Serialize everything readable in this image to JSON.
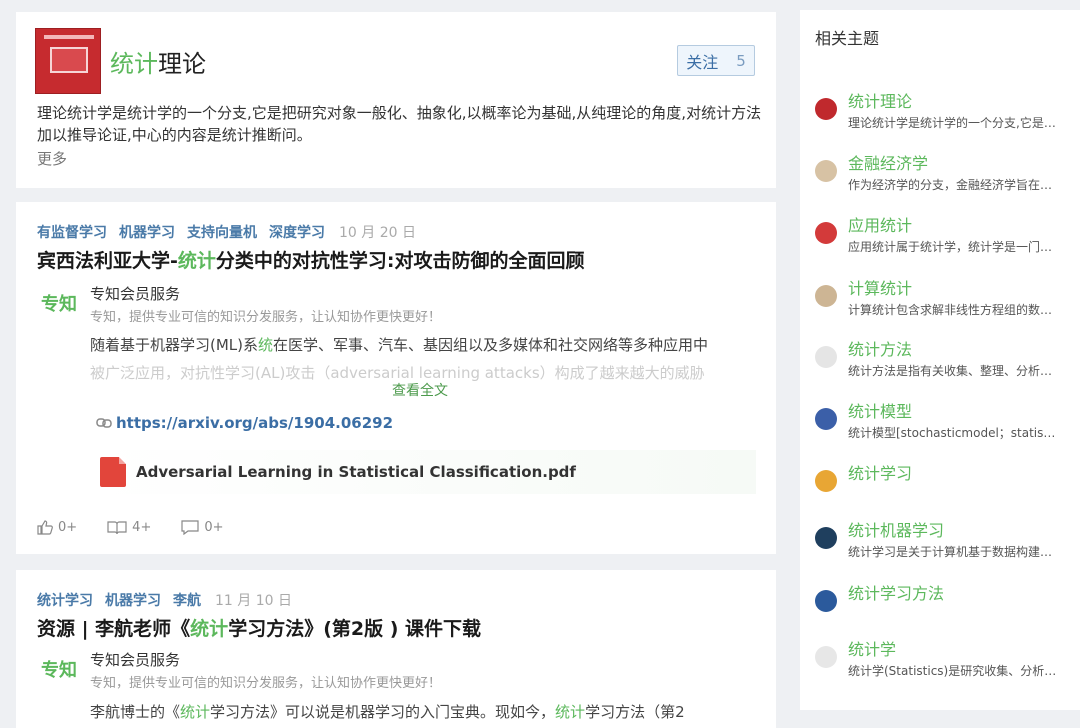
{
  "topic": {
    "title_hl": "统计",
    "title_rest": "理论",
    "follow_label": "关注",
    "follow_count": "5",
    "description": "理论统计学是统计学的一个分支,它是把研究对象一般化、抽象化,以概率论为基础,从纯理论的角度,对统计方法加以推导论证,中心的内容是统计推断问。",
    "more_label": "更多"
  },
  "articles": [
    {
      "tags": [
        "有监督学习",
        "机器学习",
        "支持向量机",
        "深度学习"
      ],
      "date": "10 月 20 日",
      "title_pre": "宾西法利亚大学-",
      "title_hl": "统计",
      "title_post": "分类中的对抗性学习:对攻击防御的全面回顾",
      "source_logo": "专知",
      "source_name": "专知会员服务",
      "source_desc": "专知，提供专业可信的知识分发服务，让认知协作更快更好！",
      "excerpt_pre": "随着基于机器学习(ML)系",
      "excerpt_hl": "统",
      "excerpt_post": "在医学、军事、汽车、基因组以及多媒体和社交网络等多种应用中",
      "excerpt_line2": "被广泛应用，对抗性学习(AL)攻击（adversarial learning attacks）构成了越来越大的威胁",
      "read_full": "查看全文",
      "link": "https://arxiv.org/abs/1904.06292",
      "pdf": "Adversarial Learning in Statistical Classification.pdf",
      "likes": "0+",
      "reads": "4+",
      "comments": "0+"
    },
    {
      "tags": [
        "统计学习",
        "机器学习",
        "李航"
      ],
      "date": "11 月 10 日",
      "title_pre": "资源 | 李航老师《",
      "title_hl": "统计",
      "title_post": "学习方法》(第2版 ) 课件下载",
      "source_logo": "专知",
      "source_name": "专知会员服务",
      "source_desc": "专知，提供专业可信的知识分发服务，让认知协作更快更好！",
      "excerpt_pre": "李航博士的《",
      "excerpt_hl": "统计",
      "excerpt_mid": "学习方法》可以说是机器学习的入门宝典。现如今，",
      "excerpt_hl2": "统计",
      "excerpt_post": "学习方法（第2"
    }
  ],
  "sidebar": {
    "heading": "相关主题",
    "items": [
      {
        "name": "统计理论",
        "desc": "理论统计学是统计学的一个分支,它是把研究对象一般化",
        "color": "#c0292d"
      },
      {
        "name": "金融经济学",
        "desc": "作为经济学的分支，金融经济学旨在研究金融市场",
        "color": "#d7c2a4"
      },
      {
        "name": "应用统计",
        "desc": "应用统计属于统计学，统计学是一门研究方法的学科",
        "color": "#d33a3a"
      },
      {
        "name": "计算统计",
        "desc": "计算统计包含求解非线性方程组的数值方法等",
        "color": "#cdb594"
      },
      {
        "name": "统计方法",
        "desc": "统计方法是指有关收集、整理、分析和解释数据的方法",
        "color": "#e5e5e5"
      },
      {
        "name": "统计模型",
        "desc": "统计模型[stochasticmodel；statistical model]",
        "color": "#3b5fa8"
      },
      {
        "name": "统计学习",
        "desc": "",
        "color": "#e8a634"
      },
      {
        "name": "统计机器学习",
        "desc": "统计学习是关于计算机基于数据构建概率统计模型",
        "color": "#1f3f5e"
      },
      {
        "name": "统计学习方法",
        "desc": "",
        "color": "#2b5a9c"
      },
      {
        "name": "统计学",
        "desc": "统计学(Statistics)是研究收集、分析、解释数据的科学",
        "color": "#e7e7e7"
      }
    ]
  }
}
